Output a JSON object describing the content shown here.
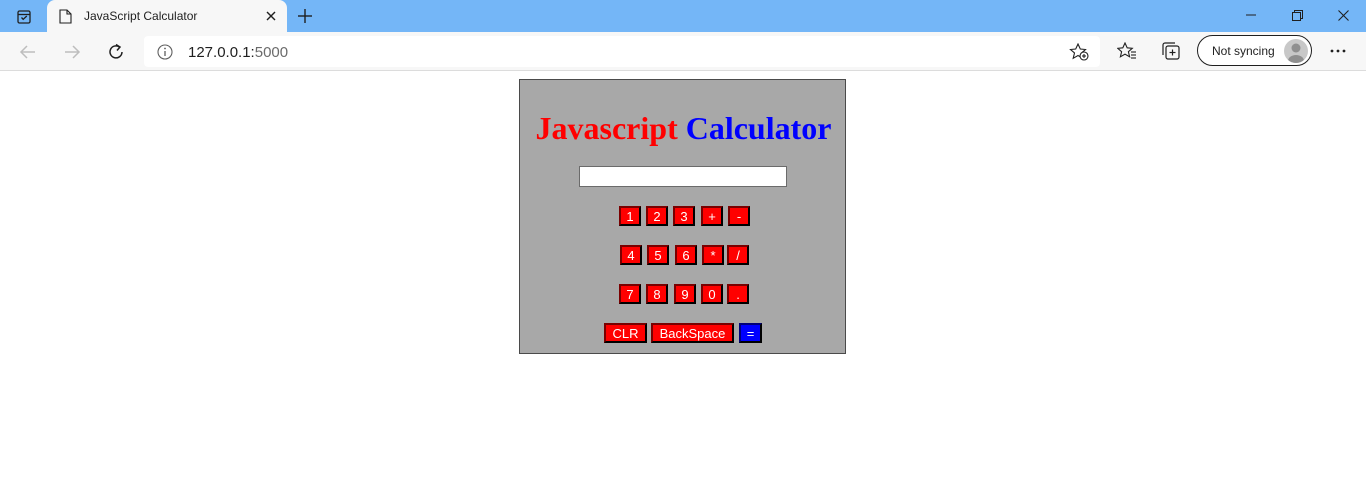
{
  "browser": {
    "tab_title": "JavaScript Calculator",
    "url_host": "127.0.0.1:",
    "url_port": "5000",
    "sync_label": "Not syncing"
  },
  "calculator": {
    "title_part1": "Javascript",
    "title_part2": "Calculator",
    "display_value": "",
    "rows": [
      [
        "1",
        "2",
        "3",
        "+",
        "-"
      ],
      [
        "4",
        "5",
        "6",
        "*",
        "/"
      ],
      [
        "7",
        "8",
        "9",
        "0",
        "."
      ]
    ],
    "clear_label": "CLR",
    "backspace_label": "BackSpace",
    "equals_label": "=",
    "colors": {
      "panel": "#a8a8a8",
      "key": "#ff0000",
      "equals_key": "#0000ff",
      "title_red": "#ff0000",
      "title_blue": "#0000ff"
    }
  }
}
